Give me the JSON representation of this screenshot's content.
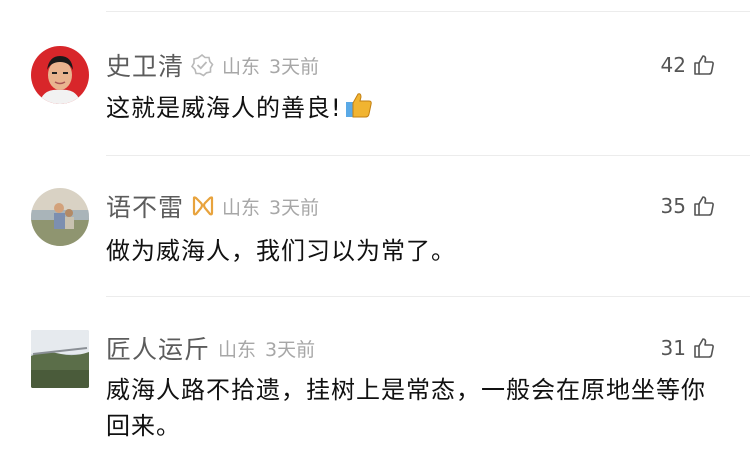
{
  "comments": [
    {
      "username": "史卫清",
      "location": "山东",
      "time": "3天前",
      "likes": "42",
      "text": "这就是威海人的善良!",
      "badge": "verified-badge-icon",
      "emoji": "thumbs-up-emoji"
    },
    {
      "username": "语不雷",
      "location": "山东",
      "time": "3天前",
      "likes": "35",
      "text": "做为威海人，我们习以为常了。",
      "badge": "member-badge-icon"
    },
    {
      "username": "匠人运斤",
      "location": "山东",
      "time": "3天前",
      "likes": "31",
      "text": "威海人路不拾遗，挂树上是常态，一般会在原地坐等你回来。"
    }
  ],
  "colors": {
    "username": "#5c5c5c",
    "meta": "#a7a7a7",
    "badge_gold": "#e8a33d",
    "divider": "#ececec"
  }
}
